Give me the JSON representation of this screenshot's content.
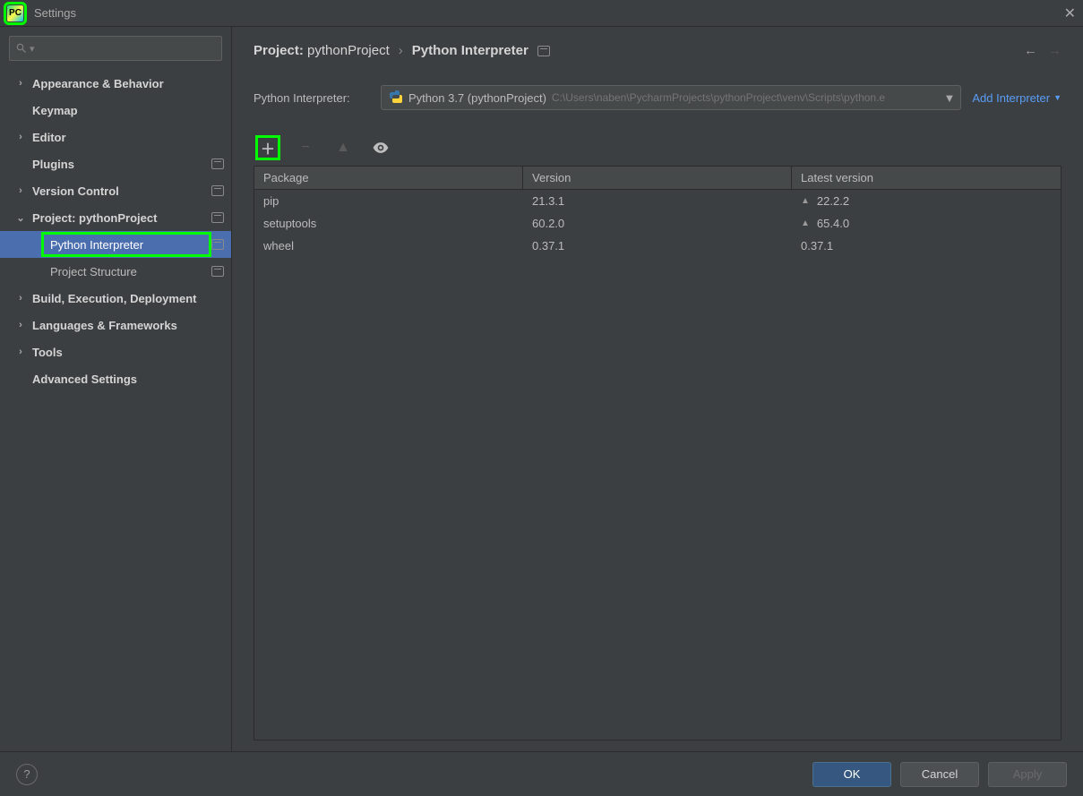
{
  "window": {
    "title": "Settings"
  },
  "sidebar": {
    "search_placeholder": "",
    "items": [
      {
        "label": "Appearance & Behavior",
        "chev": "right",
        "badge": false
      },
      {
        "label": "Keymap",
        "chev": "none",
        "badge": false
      },
      {
        "label": "Editor",
        "chev": "right",
        "badge": false
      },
      {
        "label": "Plugins",
        "chev": "none",
        "badge": true
      },
      {
        "label": "Version Control",
        "chev": "right",
        "badge": true
      },
      {
        "label": "Project: pythonProject",
        "chev": "down",
        "badge": true,
        "children": [
          {
            "label": "Python Interpreter",
            "badge": true,
            "selected": true
          },
          {
            "label": "Project Structure",
            "badge": true
          }
        ]
      },
      {
        "label": "Build, Execution, Deployment",
        "chev": "right",
        "badge": false
      },
      {
        "label": "Languages & Frameworks",
        "chev": "right",
        "badge": false
      },
      {
        "label": "Tools",
        "chev": "right",
        "badge": false
      },
      {
        "label": "Advanced Settings",
        "chev": "none",
        "badge": false
      }
    ]
  },
  "breadcrumb": {
    "part1_label": "Project:",
    "part1_value": "pythonProject",
    "part2": "Python Interpreter"
  },
  "interpreter": {
    "label": "Python Interpreter:",
    "name": "Python 3.7 (pythonProject)",
    "path": "C:\\Users\\naben\\PycharmProjects\\pythonProject\\venv\\Scripts\\python.e",
    "add_link": "Add Interpreter"
  },
  "packages": {
    "columns": {
      "c1": "Package",
      "c2": "Version",
      "c3": "Latest version"
    },
    "rows": [
      {
        "name": "pip",
        "version": "21.3.1",
        "latest": "22.2.2",
        "upgrade": true
      },
      {
        "name": "setuptools",
        "version": "60.2.0",
        "latest": "65.4.0",
        "upgrade": true
      },
      {
        "name": "wheel",
        "version": "0.37.1",
        "latest": "0.37.1",
        "upgrade": false
      }
    ]
  },
  "footer": {
    "ok": "OK",
    "cancel": "Cancel",
    "apply": "Apply"
  }
}
